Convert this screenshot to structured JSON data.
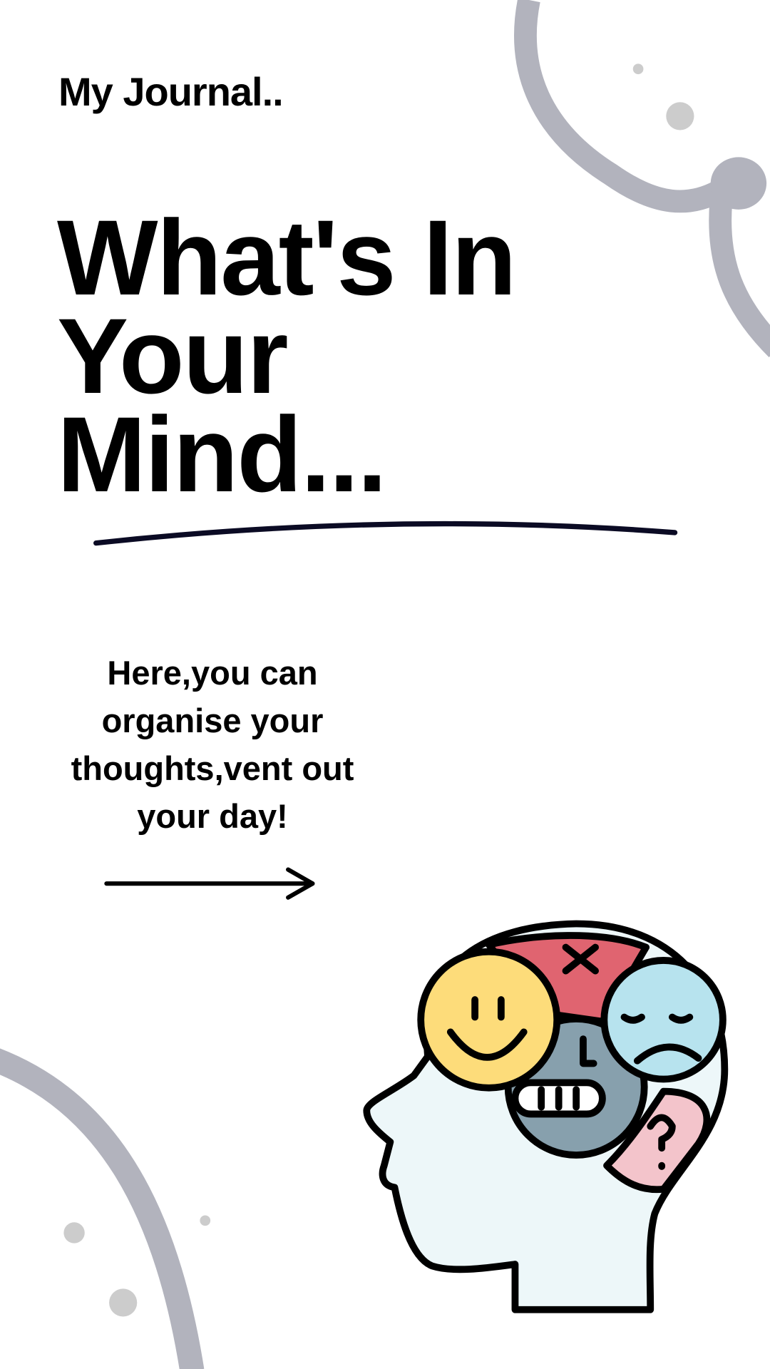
{
  "header": {
    "brand": "My Journal.."
  },
  "hero": {
    "title_lines": [
      "What's In",
      "Your",
      "Mind..."
    ]
  },
  "intro": {
    "lines": [
      "Here,you can",
      "organise your",
      "thoughts,vent out",
      "your day!"
    ]
  },
  "colors": {
    "decor": "#b2b3bd",
    "dot": "#cccccc",
    "underline": "#0b0b24",
    "happy": "#fddc7a",
    "angry": "#e06470",
    "sad": "#b7e3ee",
    "neutral": "#87a0ad",
    "confused": "#f3c4cb",
    "head": "#edf7f9"
  }
}
